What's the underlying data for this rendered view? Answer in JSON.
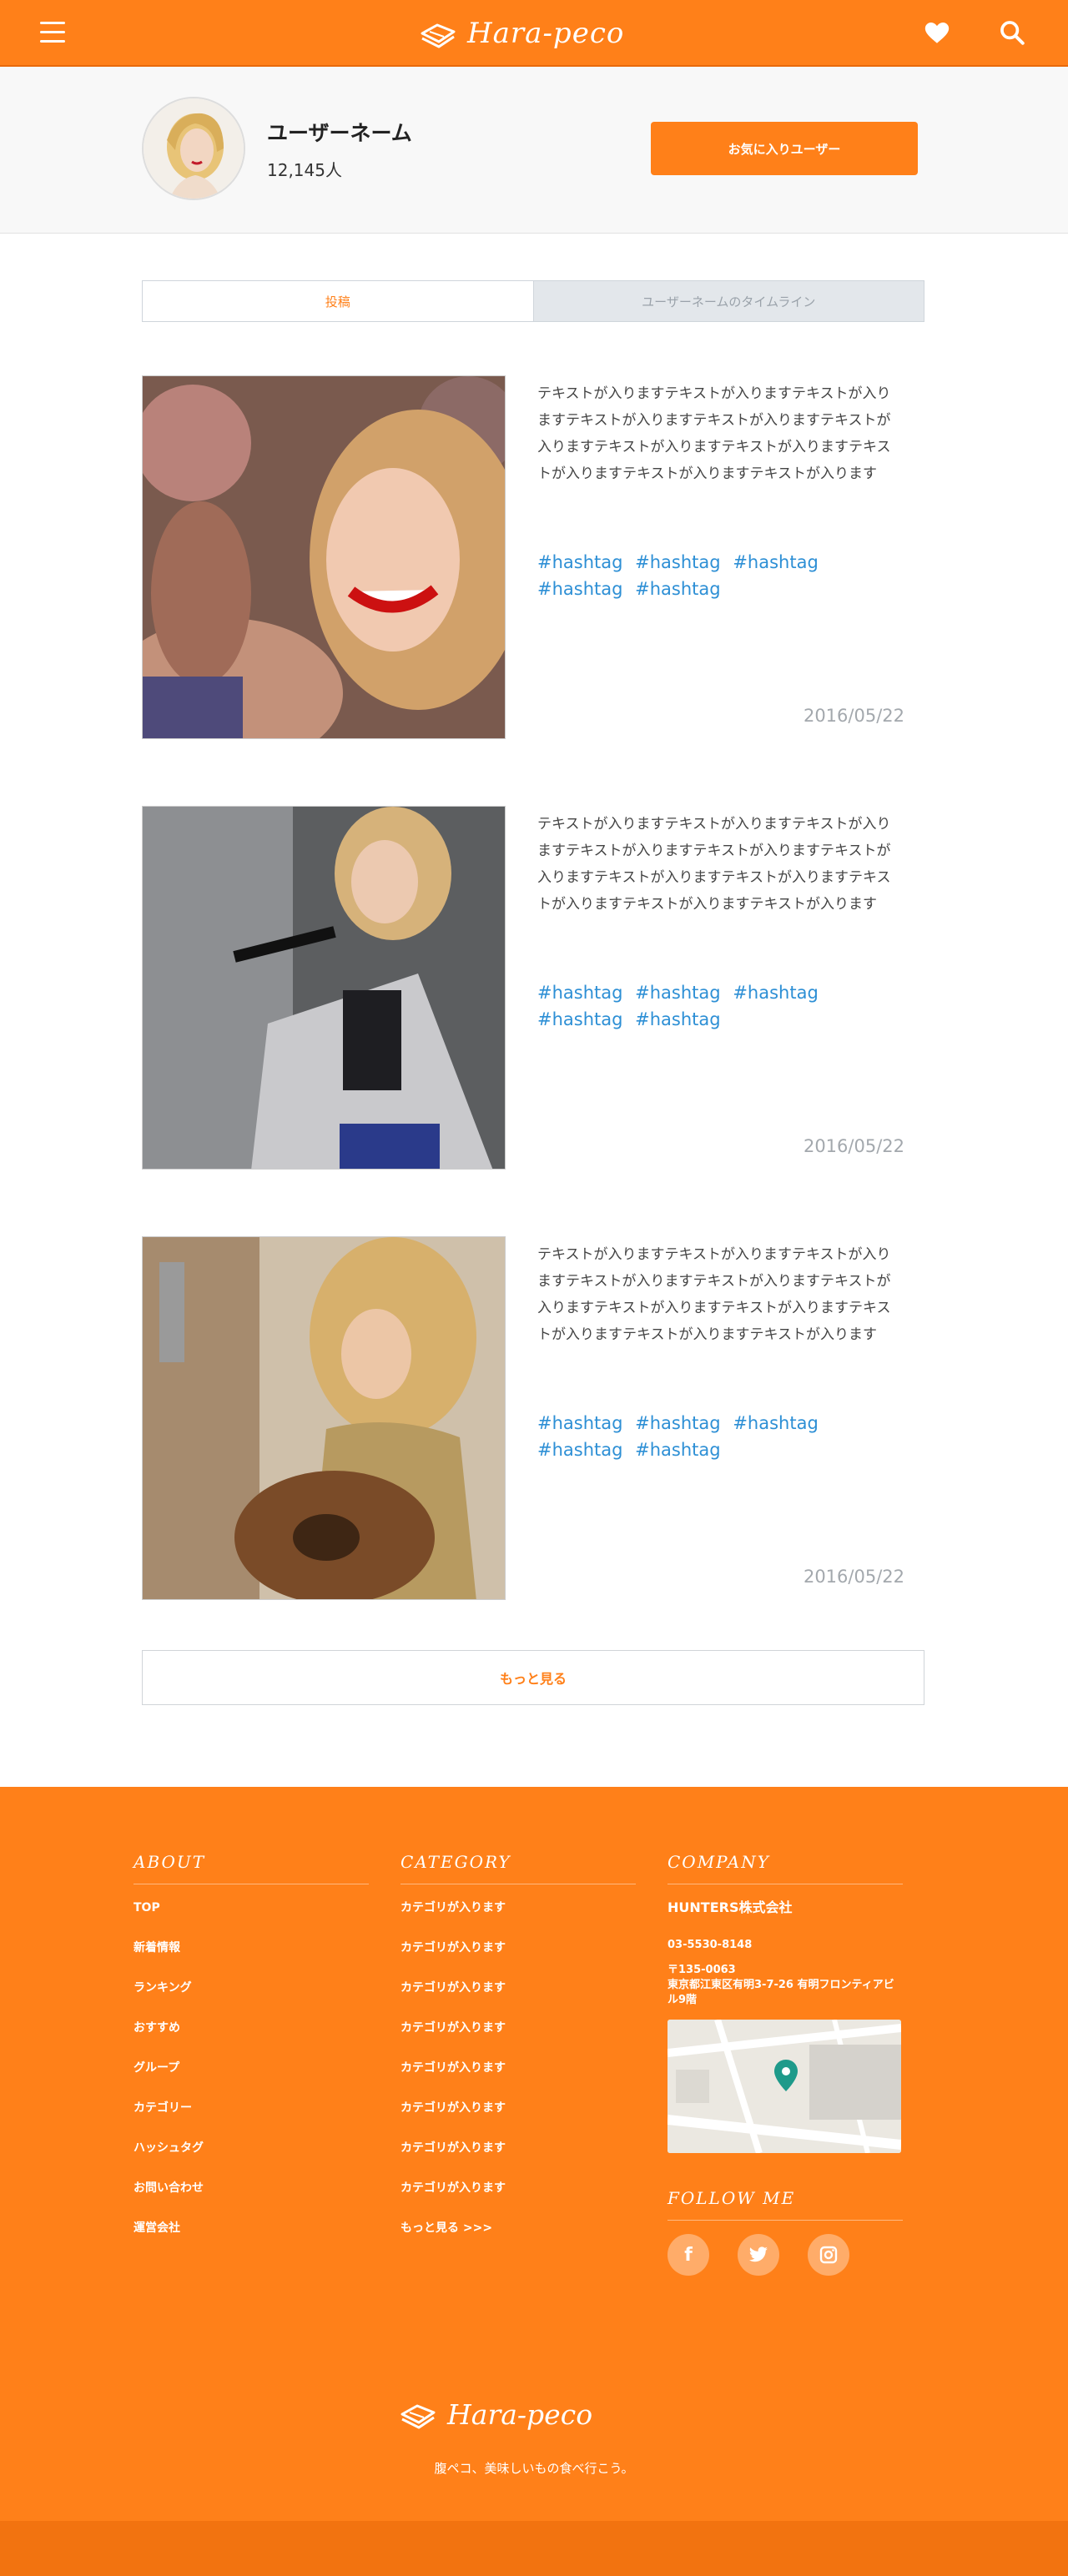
{
  "header": {
    "logo_text": "Hara-peco"
  },
  "profile": {
    "username": "ユーザーネーム",
    "followers": "12,145人",
    "fav_button": "お気に入りユーザー"
  },
  "tabs": [
    {
      "label": "投稿"
    },
    {
      "label": "ユーザーネームのタイムライン"
    }
  ],
  "posts": [
    {
      "text": "テキストが入りますテキストが入りますテキストが入りますテキストが入りますテキストが入りますテキストが入りますテキストが入りますテキストが入りますテキストが入りますテキストが入りますテキストが入ります",
      "tags": [
        "#hashtag",
        "#hashtag",
        "#hashtag",
        "#hashtag",
        "#hashtag"
      ],
      "date": "2016/05/22"
    },
    {
      "text": "テキストが入りますテキストが入りますテキストが入りますテキストが入りますテキストが入りますテキストが入りますテキストが入りますテキストが入りますテキストが入りますテキストが入りますテキストが入ります",
      "tags": [
        "#hashtag",
        "#hashtag",
        "#hashtag",
        "#hashtag",
        "#hashtag"
      ],
      "date": "2016/05/22"
    },
    {
      "text": "テキストが入りますテキストが入りますテキストが入りますテキストが入りますテキストが入りますテキストが入りますテキストが入りますテキストが入りますテキストが入りますテキストが入りますテキストが入ります",
      "tags": [
        "#hashtag",
        "#hashtag",
        "#hashtag",
        "#hashtag",
        "#hashtag"
      ],
      "date": "2016/05/22"
    }
  ],
  "more_button": "もっと見る",
  "footer": {
    "about": {
      "title": "ABOUT",
      "links": [
        "TOP",
        "新着情報",
        "ランキング",
        "おすすめ",
        "グループ",
        "カテゴリー",
        "ハッシュタグ",
        "お問い合わせ",
        "運営会社"
      ]
    },
    "category": {
      "title": "CATEGORY",
      "links": [
        "カテゴリが入ります",
        "カテゴリが入ります",
        "カテゴリが入ります",
        "カテゴリが入ります",
        "カテゴリが入ります",
        "カテゴリが入ります",
        "カテゴリが入ります",
        "カテゴリが入ります",
        "もっと見る >>>"
      ]
    },
    "company": {
      "title": "COMPANY",
      "name": "HUNTERS株式会社",
      "phone": "03-5530-8148",
      "postal": "〒135-0063",
      "address": "東京都江東区有明3-7-26 有明フロンティアビル9階"
    },
    "follow": {
      "title": "FOLLOW ME",
      "icons": [
        "facebook-icon",
        "twitter-icon",
        "instagram-icon"
      ]
    },
    "logo_text": "Hara-peco",
    "tagline": "腹ペコ、美味しいもの食べ行こう。"
  },
  "colors": {
    "brand": "#ff8019",
    "hashtag": "#2d8fd5",
    "date": "#a3a8ad"
  }
}
